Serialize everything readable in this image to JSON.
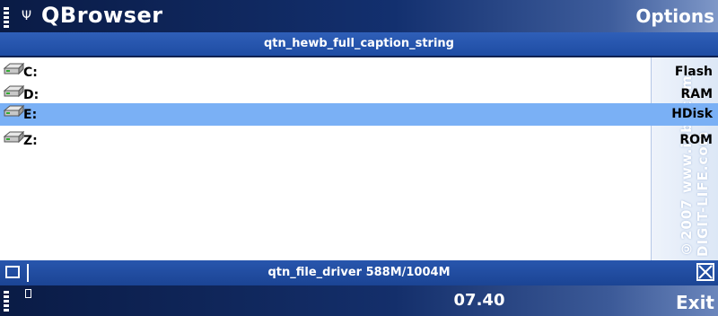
{
  "header": {
    "app_title": "QBrowser",
    "options_label": "Options"
  },
  "caption": {
    "text": "qtn_hewb_full_caption_string"
  },
  "drives": [
    {
      "name": "C:",
      "type": "Flash",
      "selected": false
    },
    {
      "name": "D:",
      "type": "RAM",
      "selected": false
    },
    {
      "name": "E:",
      "type": "HDisk",
      "selected": true
    },
    {
      "name": "Z:",
      "type": "ROM",
      "selected": false
    }
  ],
  "watermark": "©2007 www.ixbt.com DIGIT-LIFE.com",
  "status": {
    "text": "qtn_file_driver 588M/1004M"
  },
  "softkeys": {
    "clock": "07.40",
    "exit_label": "Exit"
  },
  "colors": {
    "selection": "#7ab0f5",
    "caption_bg": "#2f5fb8",
    "top_bg": "#0a1b45"
  }
}
